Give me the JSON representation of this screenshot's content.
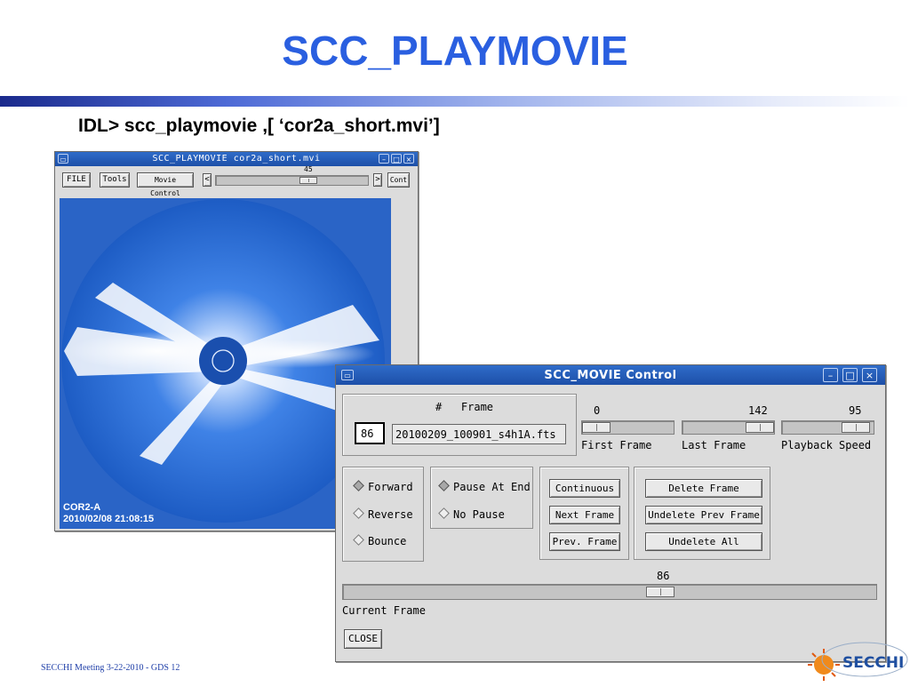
{
  "slide": {
    "title": "SCC_PLAYMOVIE",
    "command": "IDL> scc_playmovie ,[ ‘cor2a_short.mvi’]",
    "footer": "SECCHI Meeting  3-22-2010  - GDS 12",
    "logo_text": "SECCHI"
  },
  "movie_window": {
    "title": "SCC_PLAYMOVIE  cor2a_short.mvi",
    "buttons": [
      "FILE",
      "Tools",
      "Movie Control"
    ],
    "slider_value": "45",
    "slider_fraction": 0.62,
    "left_arrow": "<",
    "right_arrow": ">",
    "cont_label": "Cont",
    "image_label_line1": "COR2-A",
    "image_label_line2": "2010/02/08 21:08:15"
  },
  "control_window": {
    "title": "SCC_MOVIE Control",
    "frame_header": "#   Frame",
    "frame_number": "86",
    "frame_file": "20100209_100901_s4h1A.fts",
    "first_frame": {
      "value": "0",
      "label": "First Frame",
      "fraction": 0.0
    },
    "last_frame": {
      "value": "142",
      "label": "Last Frame",
      "fraction": 1.0
    },
    "playback_speed": {
      "value": "95",
      "label": "Playback Speed",
      "fraction": 0.95
    },
    "direction_options": [
      "Forward",
      "Reverse",
      "Bounce"
    ],
    "direction_selected": "Forward",
    "pause_options": [
      "Pause At End",
      "No Pause"
    ],
    "pause_selected": "Pause At End",
    "play_buttons": [
      "Continuous",
      "Next Frame",
      "Prev. Frame"
    ],
    "delete_buttons": [
      "Delete Frame",
      "Undelete Prev Frame",
      "Undelete All"
    ],
    "current_frame": {
      "value": "86",
      "label": "Current Frame",
      "fraction": 0.6
    },
    "close_label": "CLOSE"
  }
}
